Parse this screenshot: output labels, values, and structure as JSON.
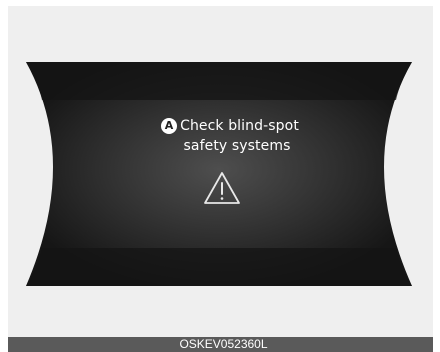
{
  "cluster_message": {
    "badge": "A",
    "line1": "Check blind-spot",
    "line2": "safety systems",
    "warning_icon": "warning-triangle-icon"
  },
  "footer": {
    "code": "OSKEV052360L"
  },
  "colors": {
    "background_panel": "#efefef",
    "display_dark": "#1b1b1b",
    "display_center": "#4a4a4a",
    "text": "#ffffff",
    "footer_bar": "#5a5a5a"
  }
}
